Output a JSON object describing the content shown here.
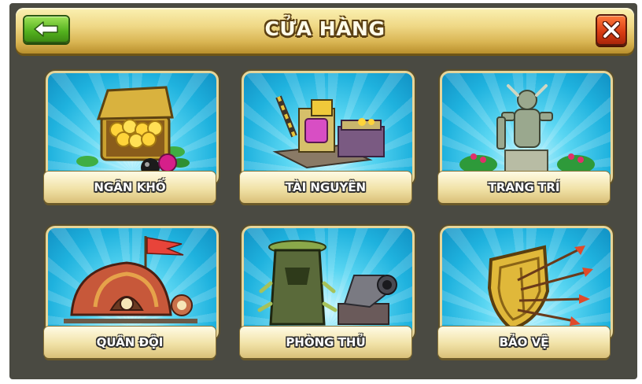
{
  "header": {
    "title": "CỬA HÀNG",
    "back_icon": "arrow-left-icon",
    "close_icon": "close-icon"
  },
  "colors": {
    "background": "#4a4a42",
    "title_bar": "#e9cf78",
    "card_sky": "#1fb2de",
    "back_button": "#53b11e",
    "close_button": "#d73a12"
  },
  "categories": [
    {
      "label": "NGÂN KHỐ",
      "icon": "treasure-chest-icon"
    },
    {
      "label": "TÀI NGUYÊN",
      "icon": "resource-buildings-icon"
    },
    {
      "label": "TRANG TRÍ",
      "icon": "statue-decoration-icon"
    },
    {
      "label": "QUÂN ĐỘI",
      "icon": "army-camp-icon"
    },
    {
      "label": "PHÒNG THỦ",
      "icon": "defense-tower-icon"
    },
    {
      "label": "BẢO VỆ",
      "icon": "shield-arrows-icon"
    }
  ]
}
